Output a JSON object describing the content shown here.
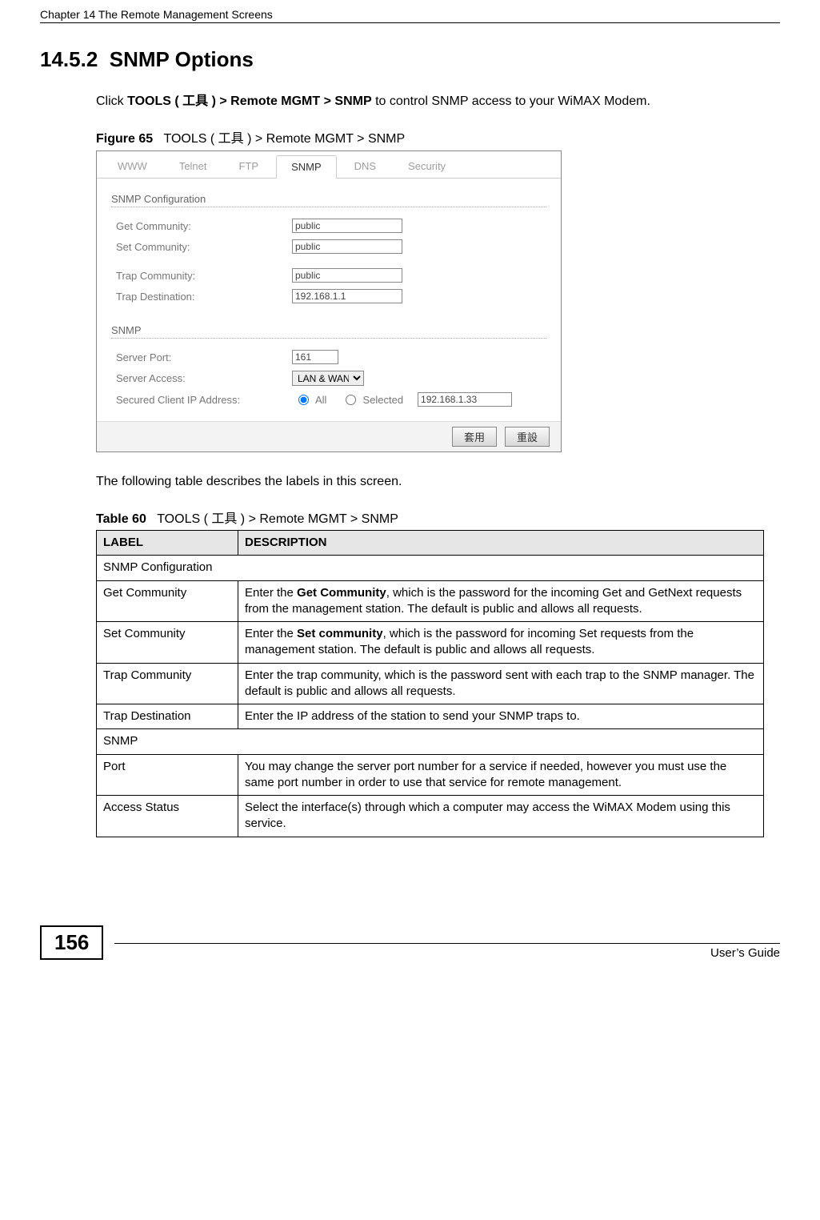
{
  "header": {
    "chapter": "Chapter 14 The Remote Management Screens"
  },
  "section": {
    "number": "14.5.2",
    "title": "SNMP Options",
    "intro_pre": "Click ",
    "intro_b1": "TOOLS ( 工具 ) > Remote MGMT > SNMP",
    "intro_post": " to control SNMP access to your WiMAX Modem."
  },
  "figure": {
    "label": "Figure 65",
    "caption": "TOOLS ( 工具 ) > Remote MGMT > SNMP"
  },
  "screenshot": {
    "tabs": {
      "www": "WWW",
      "telnet": "Telnet",
      "ftp": "FTP",
      "snmp": "SNMP",
      "dns": "DNS",
      "security": "Security"
    },
    "groups": {
      "conf": "SNMP Configuration",
      "snmp": "SNMP"
    },
    "labels": {
      "get": "Get Community:",
      "set": "Set Community:",
      "trapc": "Trap  Community:",
      "trapd": "Trap  Destination:",
      "port": "Server Port:",
      "access": "Server Access:",
      "secured": "Secured Client IP Address:"
    },
    "values": {
      "get": "public",
      "set": "public",
      "trapc": "public",
      "trapd": "192.168.1.1",
      "port": "161",
      "access": "LAN & WAN",
      "all": "All",
      "selected": "Selected",
      "securedip": "192.168.1.33"
    },
    "buttons": {
      "apply": "套用",
      "reset": "重設"
    }
  },
  "after_figure": "The following table describes the labels in this screen.",
  "table": {
    "label": "Table 60",
    "caption": "TOOLS ( 工具 ) > Remote MGMT > SNMP",
    "head": {
      "c1": "LABEL",
      "c2": "DESCRIPTION"
    },
    "rows": {
      "r0": {
        "c1": "SNMP Configuration",
        "c2": ""
      },
      "r1": {
        "c1": "Get Community",
        "c2a": "Enter the ",
        "c2b": "Get Community",
        "c2c": ", which is the password for the incoming Get and GetNext requests from the management station. The default is public and allows all requests."
      },
      "r2": {
        "c1": "Set Community",
        "c2a": "Enter the ",
        "c2b": "Set community",
        "c2c": ", which is the password for incoming Set requests from the management station. The default is public and allows all requests."
      },
      "r3": {
        "c1": "Trap Community",
        "c2": "Enter the trap community, which is the password sent with each trap to the SNMP manager. The default is public and allows all requests."
      },
      "r4": {
        "c1": "Trap Destination",
        "c2": "Enter the IP address of the station to send your SNMP traps to."
      },
      "r5": {
        "c1": "SNMP",
        "c2": ""
      },
      "r6": {
        "c1": "Port",
        "c2": "You may change the server port number for a service if needed, however you must use the same port number in order to use that service for remote management."
      },
      "r7": {
        "c1": "Access Status",
        "c2": "Select the interface(s) through which a computer may access the WiMAX Modem using this service."
      }
    }
  },
  "footer": {
    "page": "156",
    "guide": "User’s Guide"
  }
}
